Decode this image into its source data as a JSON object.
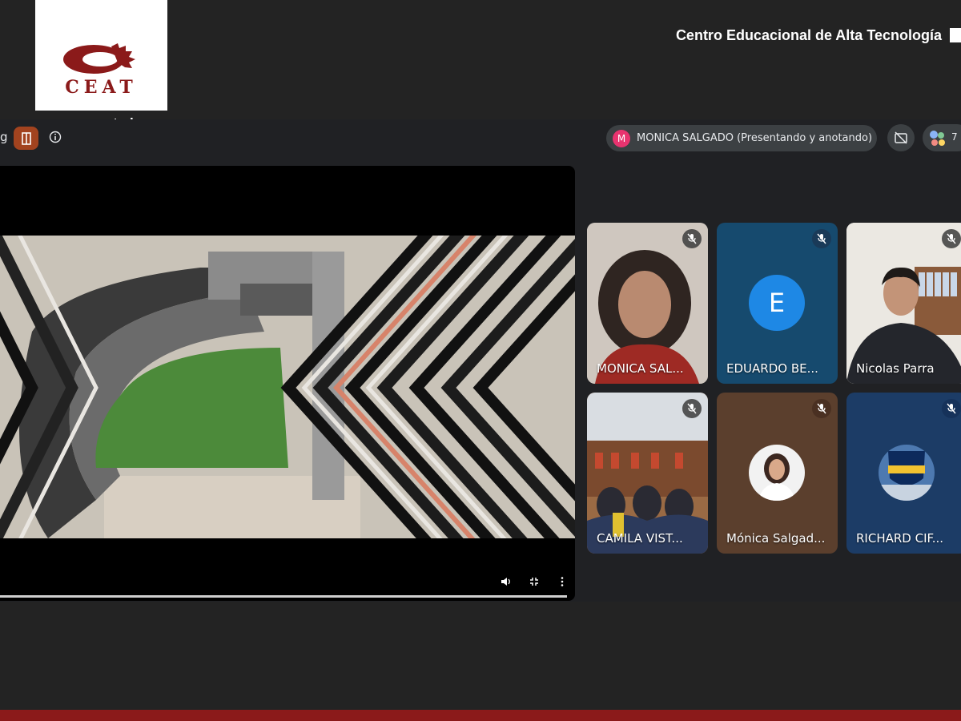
{
  "brand": {
    "logo_text": "CEAT",
    "url": "www.ceat.cl",
    "org_name": "Centro Educacional de Alta Tecnología",
    "brand_color": "#8b1a1a"
  },
  "meeting": {
    "name_tail": "g",
    "presenter": {
      "initial": "M",
      "label": "MONICA SALGADO (Presentando y anotando)",
      "avatar_color": "#e8336f"
    },
    "people_count": "7"
  },
  "participants": [
    {
      "name": "MONICA SAL...",
      "mic": "muted",
      "kind": "video"
    },
    {
      "name": "EDUARDO BE...",
      "mic": "muted",
      "kind": "letter",
      "initial": "E"
    },
    {
      "name": "Nicolas Parra",
      "mic": "muted",
      "kind": "video"
    },
    {
      "name": "CAMILA VIST...",
      "mic": "muted",
      "kind": "video"
    },
    {
      "name": "Mónica Salgad...",
      "mic": "muted",
      "kind": "photo"
    },
    {
      "name": "RICHARD CIF...",
      "mic": "muted",
      "kind": "photo"
    }
  ],
  "icons": [
    "leave-door-icon",
    "info-icon",
    "camera-off-icon",
    "people-icon",
    "mic-off-icon",
    "volume-icon",
    "exit-fullscreen-icon",
    "more-vert-icon"
  ]
}
